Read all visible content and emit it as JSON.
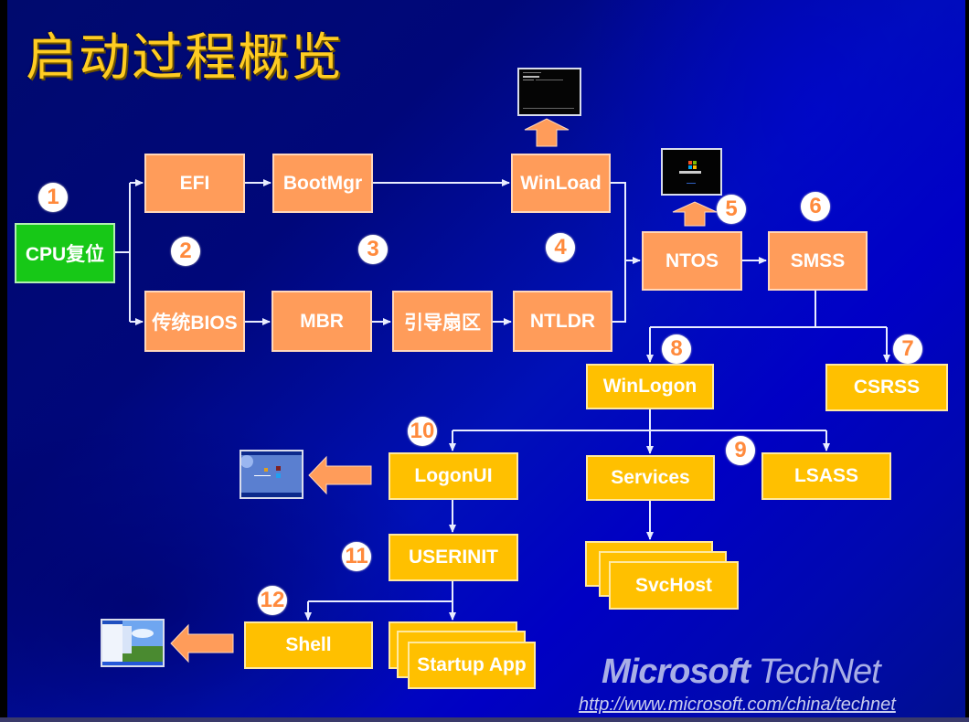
{
  "title": "启动过程概览",
  "colors": {
    "background": "#0010b8",
    "title": "#ffcc22",
    "stage1_box": "#ff9c5a",
    "stage2_box": "#ffc000",
    "start_box": "#17c817",
    "step_number": "#ff8a3c",
    "connector": "#e8ecff"
  },
  "nodes": {
    "cpu_reset": "CPU复位",
    "efi": "EFI",
    "bootmgr": "BootMgr",
    "winload": "WinLoad",
    "legacy_bios": "传统BIOS",
    "mbr": "MBR",
    "boot_sector": "引导扇区",
    "ntldr": "NTLDR",
    "ntos": "NTOS",
    "smss": "SMSS",
    "winlogon": "WinLogon",
    "csrss": "CSRSS",
    "logonui": "LogonUI",
    "services": "Services",
    "lsass": "LSASS",
    "userinit": "USERINIT",
    "svchost": "SvcHost",
    "shell": "Shell",
    "startup_app": "Startup App"
  },
  "steps": [
    "1",
    "2",
    "3",
    "4",
    "5",
    "6",
    "7",
    "8",
    "9",
    "10",
    "11",
    "12"
  ],
  "thumbnails": {
    "winload": "boot-console-screen",
    "ntos": "windows-xp-boot-screen",
    "logonui": "windows-xp-welcome-screen",
    "shell": "windows-xp-desktop"
  },
  "footer": {
    "brand_bold": "Microsoft",
    "brand_light": "TechNet",
    "url": "http://www.microsoft.com/china/technet"
  }
}
